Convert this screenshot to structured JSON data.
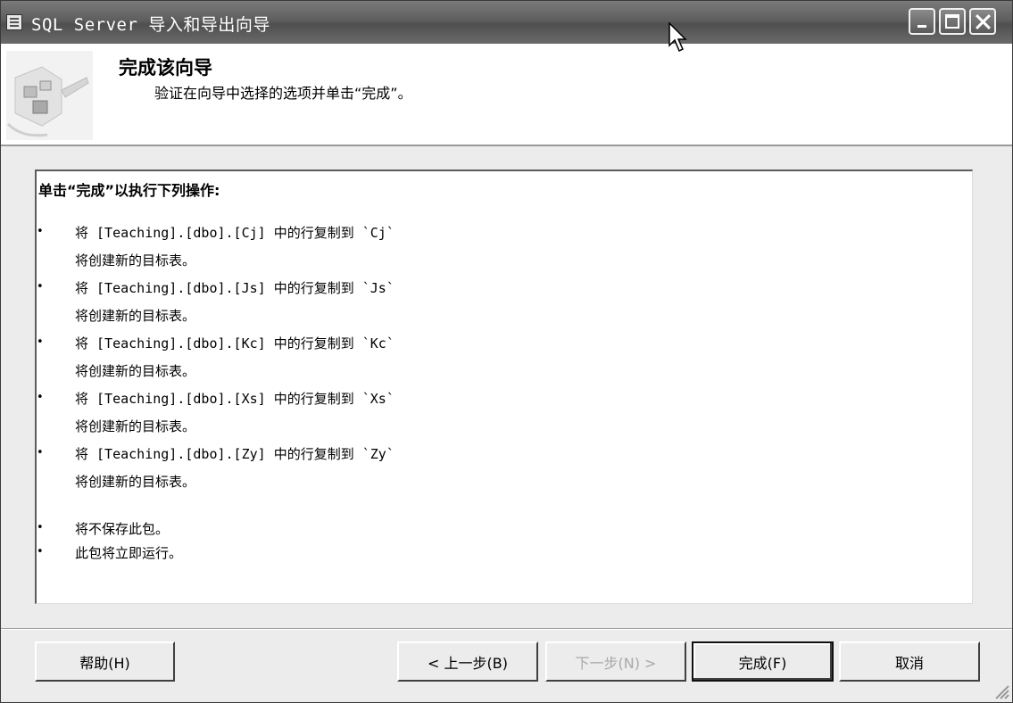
{
  "window": {
    "title": "SQL Server 导入和导出向导"
  },
  "header": {
    "title": "完成该向导",
    "subtitle": "验证在向导中选择的选项并单击“完成”。"
  },
  "summary": {
    "heading": "单击“完成”以执行下列操作:",
    "bullet_glyph": "•",
    "operations": [
      {
        "action": "将 [Teaching].[dbo].[Cj] 中的行复制到 `Cj`",
        "note": "将创建新的目标表。"
      },
      {
        "action": "将 [Teaching].[dbo].[Js] 中的行复制到 `Js`",
        "note": "将创建新的目标表。"
      },
      {
        "action": "将 [Teaching].[dbo].[Kc] 中的行复制到 `Kc`",
        "note": "将创建新的目标表。"
      },
      {
        "action": "将 [Teaching].[dbo].[Xs] 中的行复制到 `Xs`",
        "note": "将创建新的目标表。"
      },
      {
        "action": "将 [Teaching].[dbo].[Zy] 中的行复制到 `Zy`",
        "note": "将创建新的目标表。"
      }
    ],
    "package_notes": [
      "将不保存此包。",
      "此包将立即运行。"
    ]
  },
  "buttons": {
    "help": "帮助(H)",
    "back": "< 上一步(B)",
    "next": "下一步(N) >",
    "finish": "完成(F)",
    "cancel": "取消"
  }
}
